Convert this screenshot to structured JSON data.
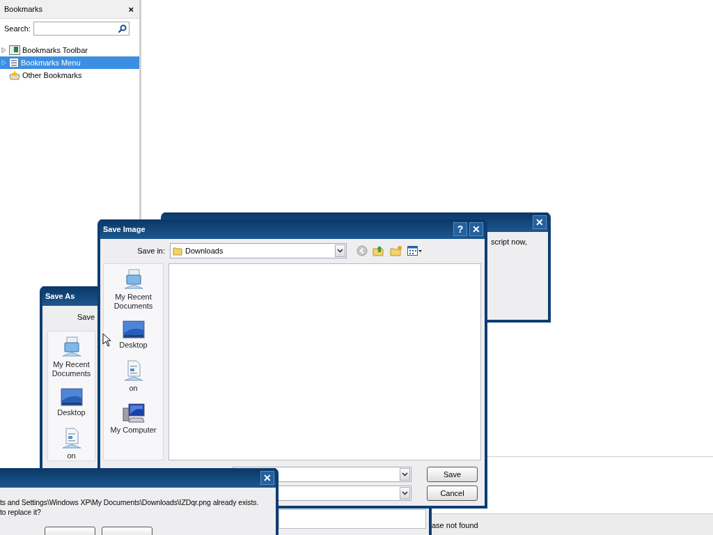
{
  "sidebar": {
    "title": "Bookmarks",
    "close": "×",
    "search_label": "Search:",
    "items": [
      {
        "label": "Bookmarks Toolbar",
        "kind": "toolbar",
        "expandable": true,
        "selected": false
      },
      {
        "label": "Bookmarks Menu",
        "kind": "menu",
        "expandable": true,
        "selected": true
      },
      {
        "label": "Other Bookmarks",
        "kind": "unsorted",
        "expandable": false,
        "selected": false
      }
    ]
  },
  "find_bar": {
    "status": "ase not found"
  },
  "script_dialog": {
    "close": "✕",
    "text": "script now,"
  },
  "save_as_dialog": {
    "title": "Save As",
    "save_in_label": "Save",
    "places": [
      {
        "label": "My Recent Documents",
        "kind": "recent"
      },
      {
        "label": "Desktop",
        "kind": "desktop"
      },
      {
        "label": "on",
        "kind": "documents"
      }
    ]
  },
  "save_image_dialog": {
    "title": "Save Image",
    "help": "?",
    "close": "✕",
    "save_in_label": "Save in:",
    "folder": "Downloads",
    "places": [
      {
        "label": "My Recent Documents",
        "kind": "recent"
      },
      {
        "label": "Desktop",
        "kind": "desktop"
      },
      {
        "label": "on",
        "kind": "documents"
      },
      {
        "label": "My Computer",
        "kind": "computer"
      }
    ],
    "buttons": [
      "Save",
      "Cancel"
    ]
  },
  "overwrite_dialog": {
    "close": "✕",
    "lines": [
      "ts and Settings\\Windows XP\\My Documents\\Downloads\\IZDqr.png already exists.",
      "to replace it?"
    ]
  }
}
